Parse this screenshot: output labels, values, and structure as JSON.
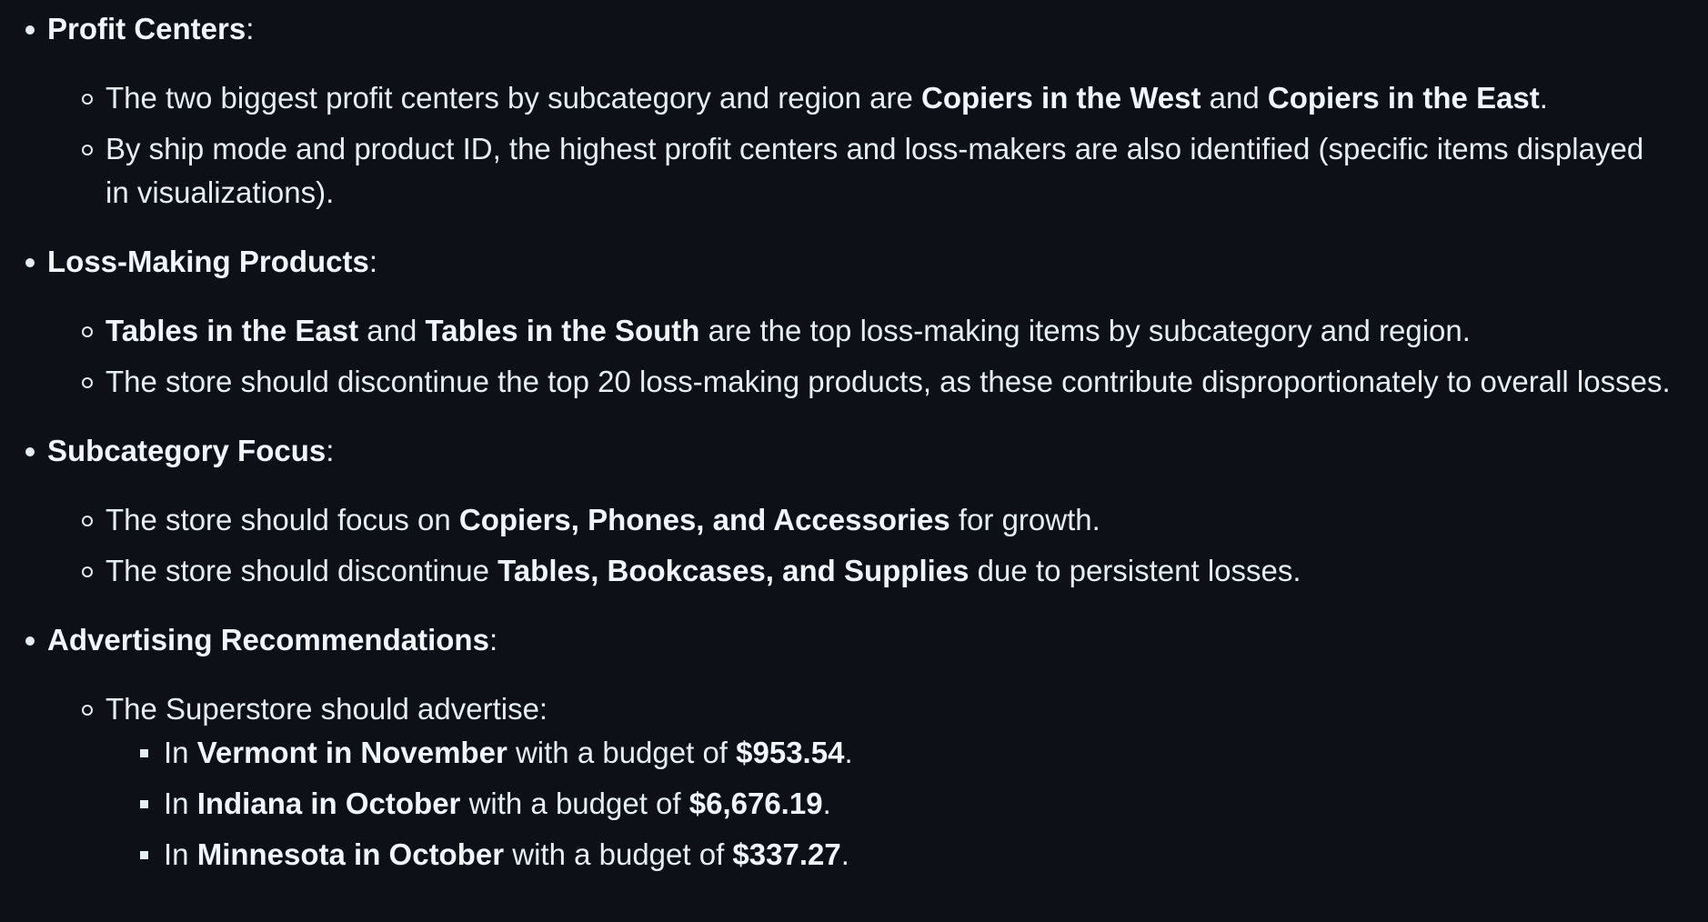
{
  "sections": [
    {
      "heading": "Profit Centers",
      "items": [
        {
          "t0": "The two biggest profit centers by subcategory and region are ",
          "b0": "Copiers in the West",
          "t1": " and ",
          "b1": "Copiers in the East",
          "t2": "."
        },
        {
          "t0": "By ship mode and product ID, the highest profit centers and loss-makers are also identified (specific items displayed in visualizations)."
        }
      ]
    },
    {
      "heading": "Loss-Making Products",
      "items": [
        {
          "b0": "Tables in the East",
          "t1": " and ",
          "b1": "Tables in the South",
          "t2": " are the top loss-making items by subcategory and region."
        },
        {
          "t0": "The store should discontinue the top 20 loss-making products, as these contribute disproportionately to overall losses."
        }
      ]
    },
    {
      "heading": "Subcategory Focus",
      "items": [
        {
          "t0": "The store should focus on ",
          "b0": "Copiers, Phones, and Accessories",
          "t1": " for growth."
        },
        {
          "t0": "The store should discontinue ",
          "b0": "Tables, Bookcases, and Supplies",
          "t1": " due to persistent losses."
        }
      ]
    },
    {
      "heading": "Advertising Recommendations",
      "items": [
        {
          "t0": "The Superstore should advertise:",
          "subitems": [
            {
              "t0": "In ",
              "b0": "Vermont in November",
              "t1": " with a budget of ",
              "b1": "$953.54",
              "t2": "."
            },
            {
              "t0": "In ",
              "b0": "Indiana in October",
              "t1": " with a budget of ",
              "b1": "$6,676.19",
              "t2": "."
            },
            {
              "t0": "In ",
              "b0": "Minnesota in October",
              "t1": " with a budget of ",
              "b1": "$337.27",
              "t2": "."
            }
          ]
        }
      ]
    }
  ],
  "heading_suffix": ":"
}
